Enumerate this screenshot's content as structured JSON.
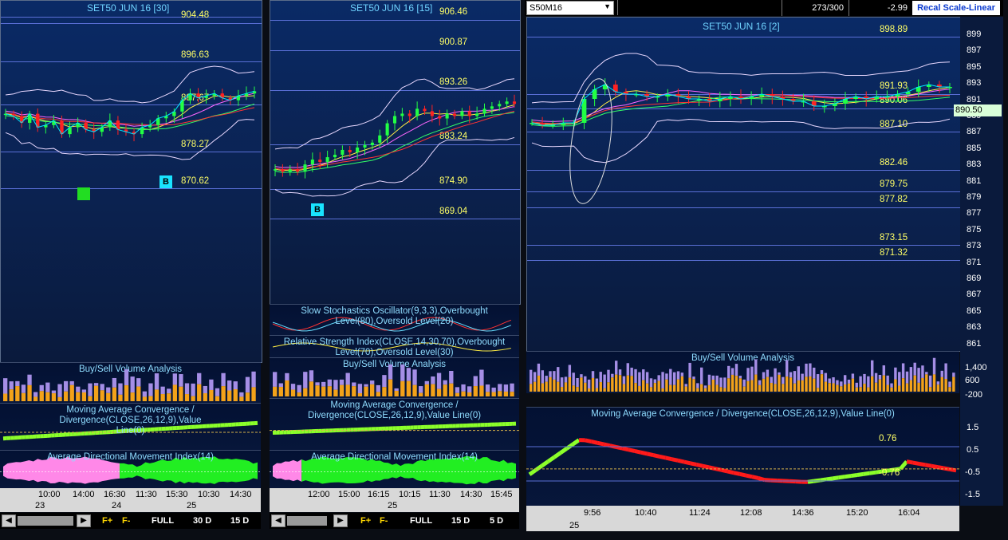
{
  "panes": {
    "p30": {
      "title": "SET50 JUN 16  [30]",
      "levels": [
        "904.48",
        "896.63",
        "887.67",
        "878.27",
        "870.62"
      ],
      "signal_b": "B",
      "times": [
        "10:00",
        "14:00",
        "16:30",
        "11:30",
        "15:30",
        "10:30",
        "14:30"
      ],
      "dates": [
        "23",
        "24",
        "25"
      ]
    },
    "p15": {
      "title": "SET50 JUN 16  [15]",
      "levels": [
        "906.46",
        "900.87",
        "893.26",
        "883.24",
        "874.90",
        "869.04"
      ],
      "signal_b": "B",
      "times": [
        "12:00",
        "15:00",
        "16:15",
        "10:15",
        "11:30",
        "14:30",
        "15:45"
      ],
      "dates": [
        "25"
      ]
    },
    "p2": {
      "title": "SET50 JUN 16  [2]",
      "levels": [
        "898.89",
        "891.93",
        "890.06",
        "887.10",
        "882.46",
        "879.75",
        "877.82",
        "873.15",
        "871.32"
      ],
      "price_tag": "890.50",
      "axis_ticks": [
        "899",
        "897",
        "895",
        "893",
        "891",
        "889",
        "887",
        "885",
        "883",
        "881",
        "879",
        "877",
        "875",
        "873",
        "871",
        "869",
        "867",
        "865",
        "863",
        "861"
      ],
      "volume_ticks": [
        "1,400",
        "600",
        "-200"
      ],
      "macd_ticks": [
        "1.5",
        "0.5",
        "-0.5",
        "-1.5"
      ],
      "macd_levels": [
        "0.76",
        "-0.76"
      ],
      "times": [
        "9:56",
        "10:40",
        "11:24",
        "12:08",
        "14:36",
        "15:20",
        "16:04"
      ],
      "dates": [
        "25"
      ]
    }
  },
  "indicators": {
    "stoch": "Slow Stochastics Oscillator(9,3,3),Overbought Level(80),Oversold Level(20)",
    "rsi": "Relative Strength Index(CLOSE,14,30,70),Overbought Level(70),Oversold Level(30)",
    "volume": "Buy/Sell Volume Analysis",
    "macd_short": "Moving Average Convergence / Divergence(CLOSE,26,12,9),Value Line(0)",
    "macd_long": "Moving Average Convergence / Divergence(CLOSE,26,12,9),Value Line(0)",
    "adx": "Average Directional Movement Index(14)"
  },
  "topbar": {
    "symbol": "S50M16",
    "count": "273/300",
    "change": "-2.99",
    "recal": "Recal Scale-Linear"
  },
  "nav": {
    "f_plus": "F+",
    "f_minus": "F-",
    "full": "FULL",
    "d30": "30 D",
    "d15": "15 D",
    "d5": "5 D"
  },
  "colors": {
    "level_text": "#ffff66",
    "title_text": "#6fd3ff",
    "price_line": "#00e5ff",
    "buy_volume": "#f3a21a",
    "sell_volume": "#a58ee6",
    "macd_up": "#8cff2a",
    "macd_down": "#ff1a1a",
    "adx_pos": "#ff88e8",
    "adx_neg": "#22ee22"
  },
  "chart_data": [
    {
      "type": "line",
      "title": "SET50 JUN 16  [30]",
      "ylim": [
        868,
        906
      ],
      "series": [
        {
          "values": [
            884.5,
            884.0,
            882.5,
            884.5,
            881.5,
            882.0,
            883.0,
            880.0,
            881.5,
            882.5,
            881.0,
            880.5,
            881.5,
            883.0,
            881.0,
            880.5,
            880.0,
            881.5,
            882.0,
            883.5,
            884.0,
            885.0,
            887.5,
            889.0,
            888.0,
            888.5,
            889.0,
            888.0,
            887.5,
            888.5,
            889.0,
            889.5
          ]
        }
      ]
    },
    {
      "type": "line",
      "title": "SET50 JUN 16  [15]",
      "ylim": [
        866,
        908
      ],
      "series": [
        {
          "values": [
            876.5,
            876.0,
            876.5,
            876.0,
            877.5,
            878.5,
            878.0,
            879.0,
            879.5,
            880.5,
            880.0,
            881.0,
            881.5,
            882.0,
            883.5,
            886.0,
            887.5,
            888.0,
            887.5,
            889.0,
            888.5,
            887.5,
            887.0,
            888.0,
            887.5,
            888.5,
            887.5,
            888.0,
            889.0,
            889.5,
            890.0,
            890.5,
            890.0
          ]
        }
      ]
    },
    {
      "type": "line",
      "title": "SET50 JUN 16  [2]",
      "ylim": [
        860,
        900
      ],
      "series": [
        {
          "values": [
            883.0,
            882.5,
            882.5,
            883.0,
            883.0,
            888.0,
            890.0,
            891.0,
            889.5,
            889.0,
            889.0,
            888.5,
            888.5,
            889.0,
            888.5,
            888.0,
            888.0,
            887.5,
            888.0,
            888.5,
            888.0,
            888.5,
            889.0,
            888.5,
            888.0,
            887.5,
            887.5,
            886.5,
            886.5,
            887.0,
            888.0,
            888.5,
            888.0,
            888.5,
            888.5,
            889.0,
            889.5,
            890.5,
            891.0,
            890.5,
            890.5
          ]
        }
      ]
    }
  ]
}
